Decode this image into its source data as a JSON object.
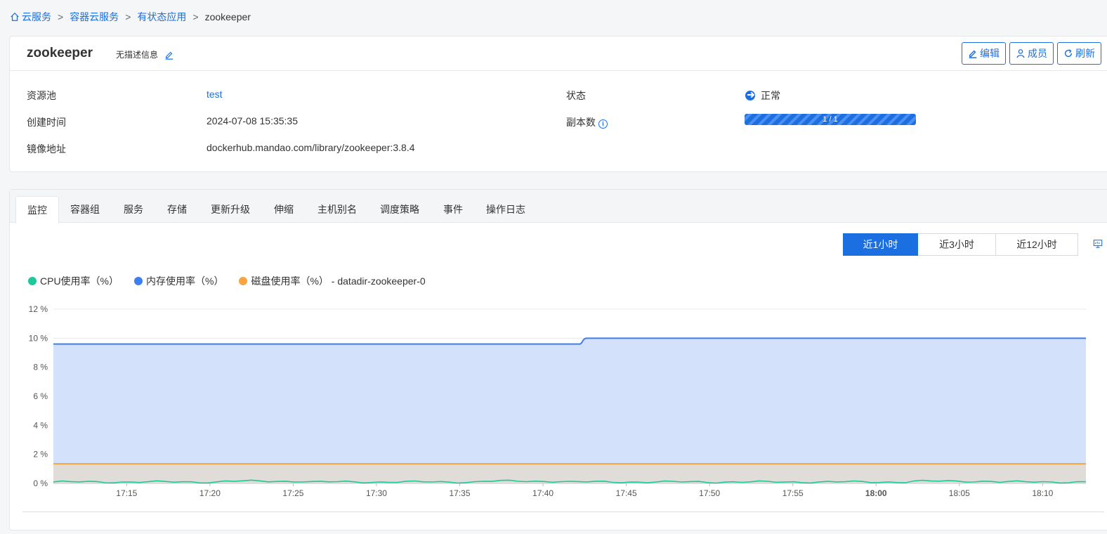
{
  "breadcrumb": {
    "items": [
      "云服务",
      "容器云服务",
      "有状态应用"
    ],
    "separator": ">",
    "current": "zookeeper"
  },
  "header": {
    "title": "zookeeper",
    "description": "无描述信息",
    "actions": {
      "edit": "编辑",
      "members": "成员",
      "refresh": "刷新"
    }
  },
  "info": {
    "pool_label": "资源池",
    "pool_value": "test",
    "created_label": "创建时间",
    "created_value": "2024-07-08 15:35:35",
    "image_label": "镜像地址",
    "image_value": "dockerhub.mandao.com/library/zookeeper:3.8.4",
    "status_label": "状态",
    "status_value": "正常",
    "replicas_label": "副本数",
    "replicas_value": "1 / 1",
    "replicas_ratio": 1.0
  },
  "tabs": [
    "监控",
    "容器组",
    "服务",
    "存储",
    "更新升级",
    "伸缩",
    "主机别名",
    "调度策略",
    "事件",
    "操作日志"
  ],
  "active_tab": "监控",
  "time_ranges": [
    "近1小时",
    "近3小时",
    "近12小时"
  ],
  "active_range": "近1小时",
  "colors": {
    "accent": "#1b6fe0",
    "cpu": "#1fc89a",
    "memory": "#3d7ef0",
    "disk": "#f7a541"
  },
  "chart_data": {
    "type": "area",
    "y_ticks": [
      "12 %",
      "10 %",
      "8 %",
      "6 %",
      "4 %",
      "2 %",
      "0 %"
    ],
    "ylim": [
      0,
      12
    ],
    "x_ticks": [
      "17:15",
      "17:20",
      "17:25",
      "17:30",
      "17:35",
      "17:40",
      "17:45",
      "17:50",
      "17:55",
      "18:00",
      "18:05",
      "18:10"
    ],
    "series": [
      {
        "name": "CPU使用率（%）",
        "color": "#1fc89a",
        "values": [
          0.1,
          0.1,
          0.15,
          0.1,
          0.1,
          0.15,
          0.1,
          0.1,
          0.1,
          0.1,
          0.15,
          0.1
        ]
      },
      {
        "name": "内存使用率（%）",
        "color": "#3d7ef0",
        "values": [
          9.6,
          9.6,
          9.6,
          9.6,
          9.6,
          9.6,
          10.0,
          10.0,
          10.0,
          10.0,
          10.0,
          10.0
        ]
      },
      {
        "name": "磁盘使用率（%） - datadir-zookeeper-0",
        "color": "#f7a541",
        "values": [
          1.35,
          1.35,
          1.35,
          1.35,
          1.35,
          1.35,
          1.35,
          1.35,
          1.35,
          1.35,
          1.35,
          1.35
        ]
      }
    ],
    "grid": true,
    "legend_position": "top-left"
  }
}
